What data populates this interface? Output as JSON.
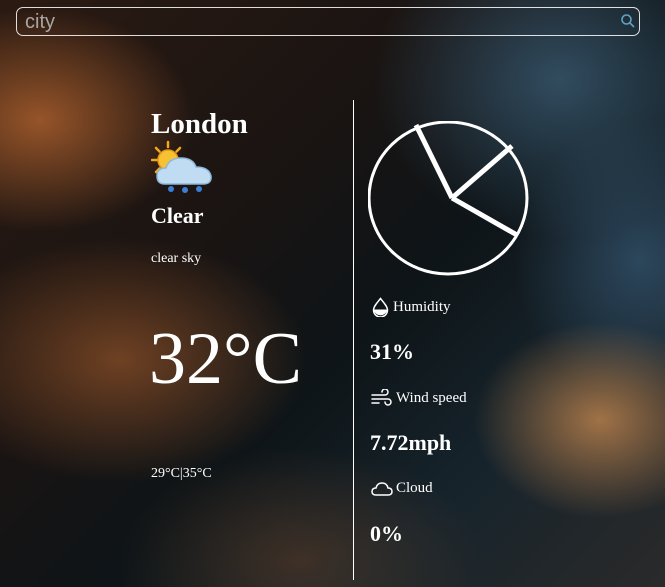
{
  "search": {
    "placeholder": "city",
    "value": ""
  },
  "weather": {
    "city": "London",
    "main": "Clear",
    "description": "clear sky",
    "temperature": "32°C",
    "min_max": "29°C|35°C",
    "icon": "partly-cloudy-rain-icon"
  },
  "details": {
    "humidity": {
      "label": "Humidity",
      "value": "31%",
      "icon": "droplet-icon"
    },
    "wind": {
      "label": "Wind speed",
      "value": "7.72mph",
      "icon": "wind-icon"
    },
    "cloud": {
      "label": "Cloud",
      "value": "0%",
      "icon": "cloud-icon"
    }
  },
  "gauge": {
    "icon": "clock-gauge-icon"
  }
}
